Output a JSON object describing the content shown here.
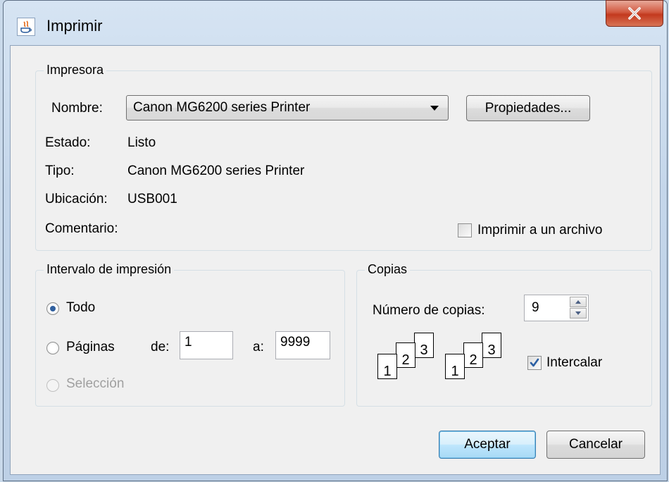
{
  "window": {
    "title": "Imprimir"
  },
  "printer_group": {
    "legend": "Impresora",
    "name_label": "Nombre:",
    "name_value": "Canon MG6200 series Printer",
    "properties_button": "Propiedades...",
    "status_label": "Estado:",
    "status_value": "Listo",
    "type_label": "Tipo:",
    "type_value": "Canon MG6200 series Printer",
    "location_label": "Ubicación:",
    "location_value": "USB001",
    "comment_label": "Comentario:",
    "print_to_file_label": "Imprimir a un archivo",
    "print_to_file_checked": false
  },
  "range_group": {
    "legend": "Intervalo de impresión",
    "all_label": "Todo",
    "pages_label": "Páginas",
    "from_label": "de:",
    "from_value": "1",
    "to_label": "a:",
    "to_value": "9999",
    "selection_label": "Selección",
    "selected": "all"
  },
  "copies_group": {
    "legend": "Copias",
    "count_label": "Número de copias:",
    "count_value": "9",
    "collate_label": "Intercalar",
    "collate_checked": true,
    "page_numbers": [
      "1",
      "2",
      "3"
    ]
  },
  "buttons": {
    "ok": "Aceptar",
    "cancel": "Cancelar"
  },
  "colors": {
    "accent_radio": "#2f5f9e",
    "check_mark": "#2b5fa3",
    "close_button": "#c3391e"
  }
}
